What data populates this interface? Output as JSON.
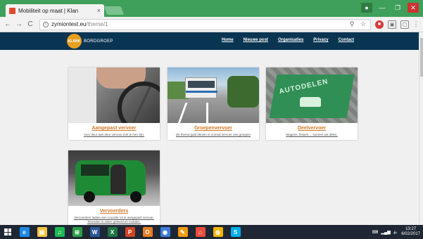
{
  "browser": {
    "tab_title": "Mobiliteit op maat | Klan",
    "tab_close": "×",
    "url_host": "zymiontest.eu",
    "url_path": "/theme/1",
    "back": "←",
    "forward": "→",
    "reload": "C",
    "info": "i",
    "zoom": "⚲",
    "star": "☆",
    "menu": "⋮"
  },
  "site": {
    "logo_mark": "KLANK",
    "logo_text": "BORDGROEP",
    "nav": [
      "Home",
      "Nieuwe post",
      "Organisaties",
      "Privacy",
      "Contact"
    ]
  },
  "cards": [
    {
      "title": "Aangepast vervoer",
      "desc": "Voor deur aan deur vervoer met je hen zijn."
    },
    {
      "title": "Groepenvervoer",
      "desc": "Dit thema gaat bleven in normal vervoer van groepen"
    },
    {
      "title": "Deelvervoer",
      "desc": "Wagens, fietsen ... kunnen we delen."
    },
    {
      "title": "Vervoerders",
      "desc": "Vervoerders laaten een cruciale rol in aangepast vervoer. Tevreden is zeker geleerd en mobiles."
    }
  ],
  "taskbar": {
    "apps": [
      {
        "label": "e",
        "color": "#1e88e5"
      },
      {
        "label": "▤",
        "color": "#f4c542"
      },
      {
        "label": "♫",
        "color": "#1db954"
      },
      {
        "label": "⊞",
        "color": "#2a9d46"
      },
      {
        "label": "W",
        "color": "#2b579a"
      },
      {
        "label": "X",
        "color": "#217346"
      },
      {
        "label": "P",
        "color": "#d04423"
      },
      {
        "label": "O",
        "color": "#e67e22"
      },
      {
        "label": "◉",
        "color": "#3b7dd8"
      },
      {
        "label": "✎",
        "color": "#f39c12"
      },
      {
        "label": "⌂",
        "color": "#e74c3c"
      },
      {
        "label": "◍",
        "color": "#f4b400"
      },
      {
        "label": "S",
        "color": "#00aff0"
      }
    ],
    "time": "13:27",
    "date": "6/02/2017"
  }
}
